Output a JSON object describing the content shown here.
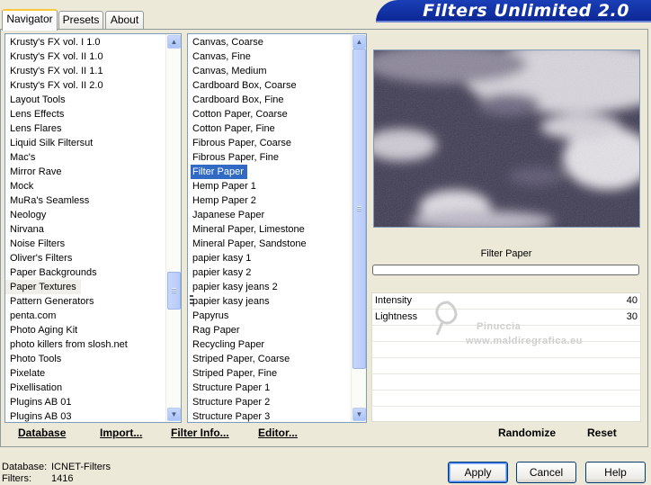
{
  "tabs": [
    "Navigator",
    "Presets",
    "About"
  ],
  "app_title": "Filters Unlimited 2.0",
  "categories": [
    "Krusty's FX vol. I 1.0",
    "Krusty's FX vol. II 1.0",
    "Krusty's FX vol. II 1.1",
    "Krusty's FX vol. II 2.0",
    "Layout Tools",
    "Lens Effects",
    "Lens Flares",
    "Liquid Silk Filtersut",
    "Mac's",
    "Mirror Rave",
    "Mock",
    "MuRa's Seamless",
    "Neology",
    "Nirvana",
    "Noise Filters",
    "Oliver's Filters",
    "Paper Backgrounds",
    "Paper Textures",
    "Pattern Generators",
    "penta.com",
    "Photo Aging Kit",
    "photo killers from slosh.net",
    "Photo Tools",
    "Pixelate",
    "Pixellisation",
    "Plugins AB 01",
    "Plugins AB 03"
  ],
  "selected_category_index": 17,
  "filters": [
    "Canvas, Coarse",
    "Canvas, Fine",
    "Canvas, Medium",
    "Cardboard Box, Coarse",
    "Cardboard Box, Fine",
    "Cotton Paper, Coarse",
    "Cotton Paper, Fine",
    "Fibrous Paper, Coarse",
    "Fibrous Paper, Fine",
    "Filter Paper",
    "Hemp Paper 1",
    "Hemp Paper 2",
    "Japanese Paper",
    "Mineral Paper, Limestone",
    "Mineral Paper, Sandstone",
    "papier kasy 1",
    "papier kasy 2",
    "papier kasy jeans 2",
    "papier kasy jeans",
    "Papyrus",
    "Rag Paper",
    "Recycling Paper",
    "Striped Paper, Coarse",
    "Striped Paper, Fine",
    "Structure Paper 1",
    "Structure Paper 2",
    "Structure Paper 3"
  ],
  "selected_filter_index": 9,
  "preview": {
    "filter_name": "Filter Paper"
  },
  "params": [
    {
      "name": "Intensity",
      "value": "40"
    },
    {
      "name": "Lightness",
      "value": "30"
    }
  ],
  "watermark": {
    "line1": "Pinuccia",
    "line2": "www.maldiregrafica.eu"
  },
  "toolbar": {
    "database": "Database",
    "import": "Import...",
    "filter_info": "Filter Info...",
    "editor": "Editor...",
    "randomize": "Randomize",
    "reset": "Reset"
  },
  "status": {
    "database_label": "Database:",
    "database_value": "ICNET-Filters",
    "filters_label": "Filters:",
    "filters_value": "1416"
  },
  "buttons": {
    "apply": "Apply",
    "cancel": "Cancel",
    "help": "Help"
  },
  "colors": {
    "banner": "#0b2692",
    "selection": "#316ac5",
    "preview_dark": "#3c3850",
    "preview_light": "#d9d6de"
  }
}
